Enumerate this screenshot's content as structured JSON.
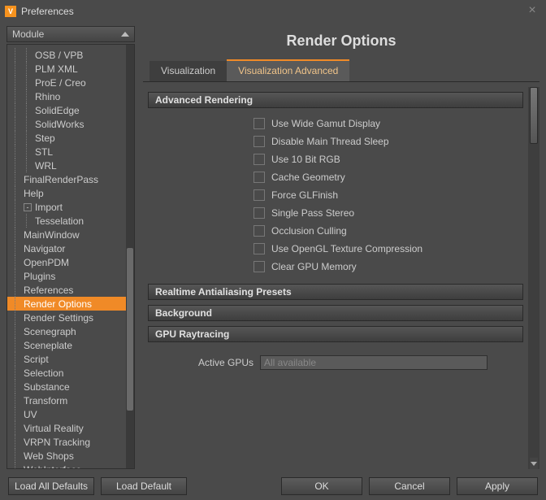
{
  "titlebar": {
    "title": "Preferences"
  },
  "module_header": "Module",
  "tree": [
    {
      "label": "OSB / VPB",
      "indent": 2
    },
    {
      "label": "PLM XML",
      "indent": 2
    },
    {
      "label": "ProE / Creo",
      "indent": 2
    },
    {
      "label": "Rhino",
      "indent": 2
    },
    {
      "label": "SolidEdge",
      "indent": 2
    },
    {
      "label": "SolidWorks",
      "indent": 2
    },
    {
      "label": "Step",
      "indent": 2
    },
    {
      "label": "STL",
      "indent": 2
    },
    {
      "label": "WRL",
      "indent": 2
    },
    {
      "label": "FinalRenderPass",
      "indent": 1
    },
    {
      "label": "Help",
      "indent": 1
    },
    {
      "label": "Import",
      "indent": 1,
      "toggle": "-"
    },
    {
      "label": "Tesselation",
      "indent": 2
    },
    {
      "label": "MainWindow",
      "indent": 1
    },
    {
      "label": "Navigator",
      "indent": 1
    },
    {
      "label": "OpenPDM",
      "indent": 1
    },
    {
      "label": "Plugins",
      "indent": 1
    },
    {
      "label": "References",
      "indent": 1
    },
    {
      "label": "Render Options",
      "indent": 1,
      "selected": true
    },
    {
      "label": "Render Settings",
      "indent": 1
    },
    {
      "label": "Scenegraph",
      "indent": 1
    },
    {
      "label": "Sceneplate",
      "indent": 1
    },
    {
      "label": "Script",
      "indent": 1
    },
    {
      "label": "Selection",
      "indent": 1
    },
    {
      "label": "Substance",
      "indent": 1
    },
    {
      "label": "Transform",
      "indent": 1
    },
    {
      "label": "UV",
      "indent": 1
    },
    {
      "label": "Virtual Reality",
      "indent": 1
    },
    {
      "label": "VRPN Tracking",
      "indent": 1
    },
    {
      "label": "Web Shops",
      "indent": 1
    },
    {
      "label": "WebInterface",
      "indent": 1
    }
  ],
  "panel": {
    "title": "Render Options",
    "tabs": {
      "visualization": "Visualization",
      "visualization_advanced": "Visualization Advanced"
    },
    "sections": {
      "advanced_rendering": {
        "title": "Advanced Rendering",
        "options": {
          "wide_gamut": "Use Wide Gamut Display",
          "disable_sleep": "Disable Main Thread Sleep",
          "use_10bit": "Use 10 Bit RGB",
          "cache_geometry": "Cache Geometry",
          "force_glfinish": "Force GLFinish",
          "single_pass_stereo": "Single Pass Stereo",
          "occlusion_culling": "Occlusion Culling",
          "opengl_tex_comp": "Use OpenGL Texture Compression",
          "clear_gpu_mem": "Clear GPU Memory"
        }
      },
      "realtime_aa": {
        "title": "Realtime Antialiasing Presets"
      },
      "background": {
        "title": "Background"
      },
      "gpu_raytracing": {
        "title": "GPU Raytracing",
        "active_gpus_label": "Active GPUs",
        "active_gpus_value": "All available"
      }
    }
  },
  "footer": {
    "load_all_defaults": "Load All Defaults",
    "load_default": "Load Default",
    "ok": "OK",
    "cancel": "Cancel",
    "apply": "Apply"
  }
}
